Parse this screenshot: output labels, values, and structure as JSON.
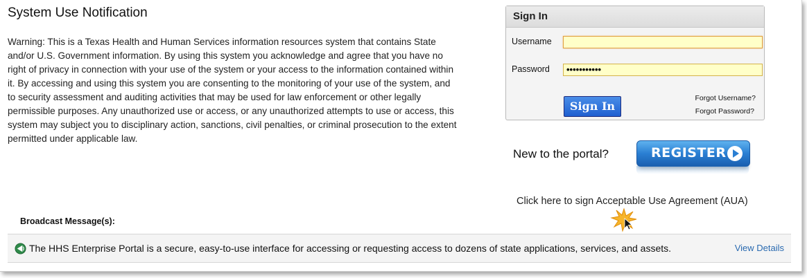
{
  "notice": {
    "title": "System Use Notification",
    "body": "Warning: This is a Texas Health and Human Services information resources system that contains State and/or U.S. Government information. By using this system you acknowledge and agree that you have no right of privacy in connection with your use of the system or your access to the information contained within it. By accessing and using this system you are consenting to the monitoring of your use of the system, and to security assessment and auditing activities that may be used for law enforcement or other legally permissible purposes. Any unauthorized use or access, or any unauthorized attempts to use or access, this system may subject you to disciplinary action, sanctions, civil penalties, or criminal prosecution to the extent permitted under applicable law."
  },
  "signin": {
    "title": "Sign In",
    "username_label": "Username",
    "username_value": "",
    "password_label": "Password",
    "password_value": "•••••••••••",
    "button_label": "Sign In",
    "forgot_username": "Forgot Username?",
    "forgot_password": "Forgot Password?"
  },
  "register": {
    "prompt": "New to the portal?",
    "button_label": "REGISTER"
  },
  "aua": {
    "link_text": "Click here to sign Acceptable Use Agreement (AUA)"
  },
  "broadcast": {
    "label": "Broadcast Message(s):",
    "message": "The HHS Enterprise Portal is a secure, easy-to-use interface for accessing or requesting access to dozens of state applications, services, and assets.",
    "view_details": "View Details"
  },
  "colors": {
    "signin_button": "#1f5fd0",
    "register_button": "#2a7fd3",
    "link": "#2a6ab0",
    "input_fill": "#ffffc8"
  },
  "icons": {
    "broadcast": "broadcast-icon",
    "register_arrow": "play-arrow-icon",
    "highlight": "starburst-icon"
  }
}
